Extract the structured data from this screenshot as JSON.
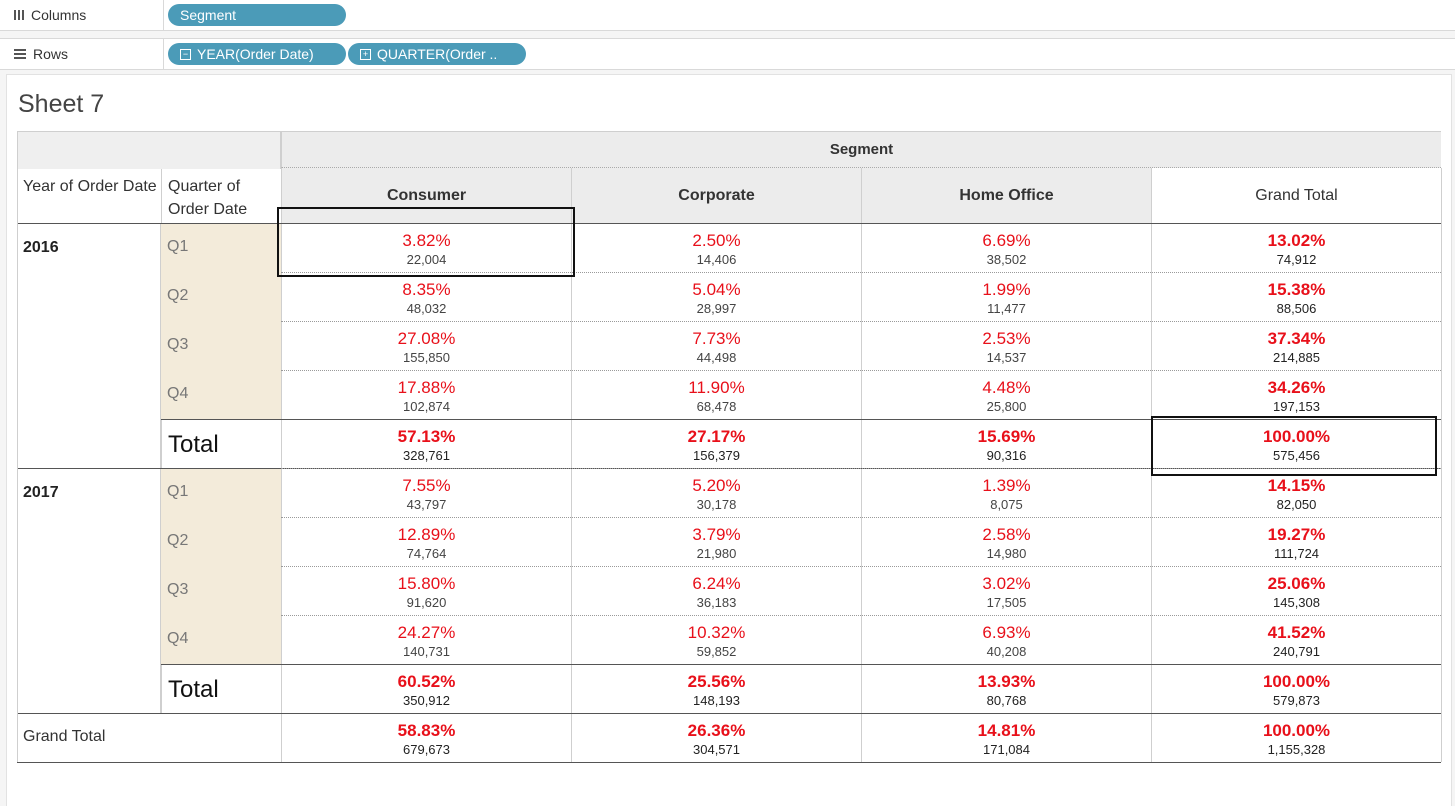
{
  "shelves": {
    "columns": {
      "label": "Columns",
      "pills": [
        {
          "label": "Segment"
        }
      ]
    },
    "rows": {
      "label": "Rows",
      "pills": [
        {
          "label": "YEAR(Order Date)",
          "icon": "collapse-icon"
        },
        {
          "label": "QUARTER(Order ..",
          "icon": "expand-icon"
        }
      ]
    }
  },
  "sheet": {
    "title": "Sheet 7"
  },
  "table": {
    "segment_header": "Segment",
    "row_headers": [
      "Year of Order Date",
      "Quarter of Order Date"
    ],
    "columns": [
      "Consumer",
      "Corporate",
      "Home Office",
      "Grand Total"
    ],
    "years": [
      {
        "year": "2016",
        "rows": [
          {
            "label": "Q1",
            "cells": [
              {
                "pct": "3.82%",
                "val": "22,004"
              },
              {
                "pct": "2.50%",
                "val": "14,406"
              },
              {
                "pct": "6.69%",
                "val": "38,502"
              },
              {
                "pct": "13.02%",
                "val": "74,912"
              }
            ]
          },
          {
            "label": "Q2",
            "cells": [
              {
                "pct": "8.35%",
                "val": "48,032"
              },
              {
                "pct": "5.04%",
                "val": "28,997"
              },
              {
                "pct": "1.99%",
                "val": "11,477"
              },
              {
                "pct": "15.38%",
                "val": "88,506"
              }
            ]
          },
          {
            "label": "Q3",
            "cells": [
              {
                "pct": "27.08%",
                "val": "155,850"
              },
              {
                "pct": "7.73%",
                "val": "44,498"
              },
              {
                "pct": "2.53%",
                "val": "14,537"
              },
              {
                "pct": "37.34%",
                "val": "214,885"
              }
            ]
          },
          {
            "label": "Q4",
            "cells": [
              {
                "pct": "17.88%",
                "val": "102,874"
              },
              {
                "pct": "11.90%",
                "val": "68,478"
              },
              {
                "pct": "4.48%",
                "val": "25,800"
              },
              {
                "pct": "34.26%",
                "val": "197,153"
              }
            ]
          }
        ],
        "total": {
          "label": "Total",
          "cells": [
            {
              "pct": "57.13%",
              "val": "328,761"
            },
            {
              "pct": "27.17%",
              "val": "156,379"
            },
            {
              "pct": "15.69%",
              "val": "90,316"
            },
            {
              "pct": "100.00%",
              "val": "575,456"
            }
          ]
        }
      },
      {
        "year": "2017",
        "rows": [
          {
            "label": "Q1",
            "cells": [
              {
                "pct": "7.55%",
                "val": "43,797"
              },
              {
                "pct": "5.20%",
                "val": "30,178"
              },
              {
                "pct": "1.39%",
                "val": "8,075"
              },
              {
                "pct": "14.15%",
                "val": "82,050"
              }
            ]
          },
          {
            "label": "Q2",
            "cells": [
              {
                "pct": "12.89%",
                "val": "74,764"
              },
              {
                "pct": "3.79%",
                "val": "21,980"
              },
              {
                "pct": "2.58%",
                "val": "14,980"
              },
              {
                "pct": "19.27%",
                "val": "111,724"
              }
            ]
          },
          {
            "label": "Q3",
            "cells": [
              {
                "pct": "15.80%",
                "val": "91,620"
              },
              {
                "pct": "6.24%",
                "val": "36,183"
              },
              {
                "pct": "3.02%",
                "val": "17,505"
              },
              {
                "pct": "25.06%",
                "val": "145,308"
              }
            ]
          },
          {
            "label": "Q4",
            "cells": [
              {
                "pct": "24.27%",
                "val": "140,731"
              },
              {
                "pct": "10.32%",
                "val": "59,852"
              },
              {
                "pct": "6.93%",
                "val": "40,208"
              },
              {
                "pct": "41.52%",
                "val": "240,791"
              }
            ]
          }
        ],
        "total": {
          "label": "Total",
          "cells": [
            {
              "pct": "60.52%",
              "val": "350,912"
            },
            {
              "pct": "25.56%",
              "val": "148,193"
            },
            {
              "pct": "13.93%",
              "val": "80,768"
            },
            {
              "pct": "100.00%",
              "val": "579,873"
            }
          ]
        }
      }
    ],
    "grand_total": {
      "label": "Grand Total",
      "cells": [
        {
          "pct": "58.83%",
          "val": "679,673"
        },
        {
          "pct": "26.36%",
          "val": "304,571"
        },
        {
          "pct": "14.81%",
          "val": "171,084"
        },
        {
          "pct": "100.00%",
          "val": "1,155,328"
        }
      ]
    }
  },
  "colors": {
    "pill": "#4b9bb8",
    "percent": "#e8101a",
    "quarter_bg": "#f3ebda"
  }
}
